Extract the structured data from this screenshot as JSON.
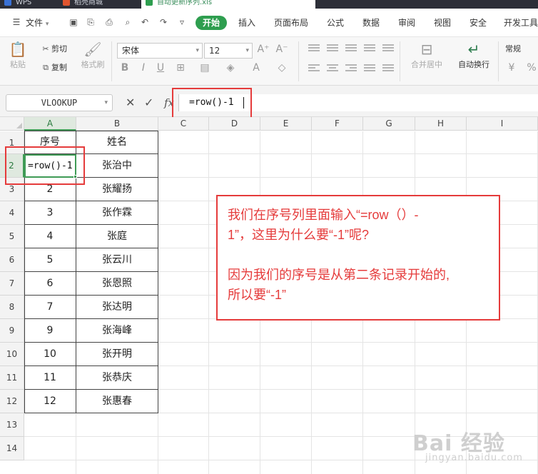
{
  "titlebar": {
    "tabs": [
      {
        "label": "WPS",
        "color": "#3a72d6"
      },
      {
        "label": "稻壳商城",
        "color": "#e0552f"
      },
      {
        "label": "自动更新序列.xls",
        "color": "#2e9e4f"
      }
    ]
  },
  "menu": {
    "file_label": "文件",
    "items": [
      "开始",
      "插入",
      "页面布局",
      "公式",
      "数据",
      "审阅",
      "视图",
      "安全",
      "开发工具"
    ]
  },
  "ribbon": {
    "paste": "粘贴",
    "cut": "剪切",
    "copy": "复制",
    "format_painter": "格式刷",
    "font_name": "宋体",
    "font_size": "12",
    "merge_center": "合并居中",
    "wrap_text": "自动换行",
    "number_format": "常规"
  },
  "formula_bar": {
    "name_box": "VLOOKUP",
    "fx": "fx",
    "formula": "=row()-1"
  },
  "sheet": {
    "columns": [
      "A",
      "B",
      "C",
      "D",
      "E",
      "F",
      "G",
      "H",
      "I"
    ],
    "rows": [
      "1",
      "2",
      "3",
      "4",
      "5",
      "6",
      "7",
      "8",
      "9",
      "10",
      "11",
      "12",
      "13",
      "14"
    ],
    "header_row": {
      "a": "序号",
      "b": "姓名"
    },
    "editing_value": "=row()-1",
    "data": [
      {
        "a": "",
        "b": "张治中"
      },
      {
        "a": "2",
        "b": "张耀扬"
      },
      {
        "a": "3",
        "b": "张作霖"
      },
      {
        "a": "4",
        "b": "张庭"
      },
      {
        "a": "5",
        "b": "张云川"
      },
      {
        "a": "6",
        "b": "张恩照"
      },
      {
        "a": "7",
        "b": "张达明"
      },
      {
        "a": "9",
        "b": "张海峰"
      },
      {
        "a": "10",
        "b": "张开明"
      },
      {
        "a": "11",
        "b": "张恭庆"
      },
      {
        "a": "12",
        "b": "张惠春"
      }
    ]
  },
  "annotation": {
    "line1": "我们在序号列里面输入“=row（）-",
    "line2": "1”，这里为什么要“-1”呢?",
    "line3": "因为我们的序号是从第二条记录开始的,",
    "line4": "所以要“-1”"
  },
  "watermark": {
    "logo": "Bai  经验",
    "sub": "jingyan.baidu.com"
  },
  "colors": {
    "accent": "#2e9e4f",
    "highlight": "#e53b3b"
  }
}
